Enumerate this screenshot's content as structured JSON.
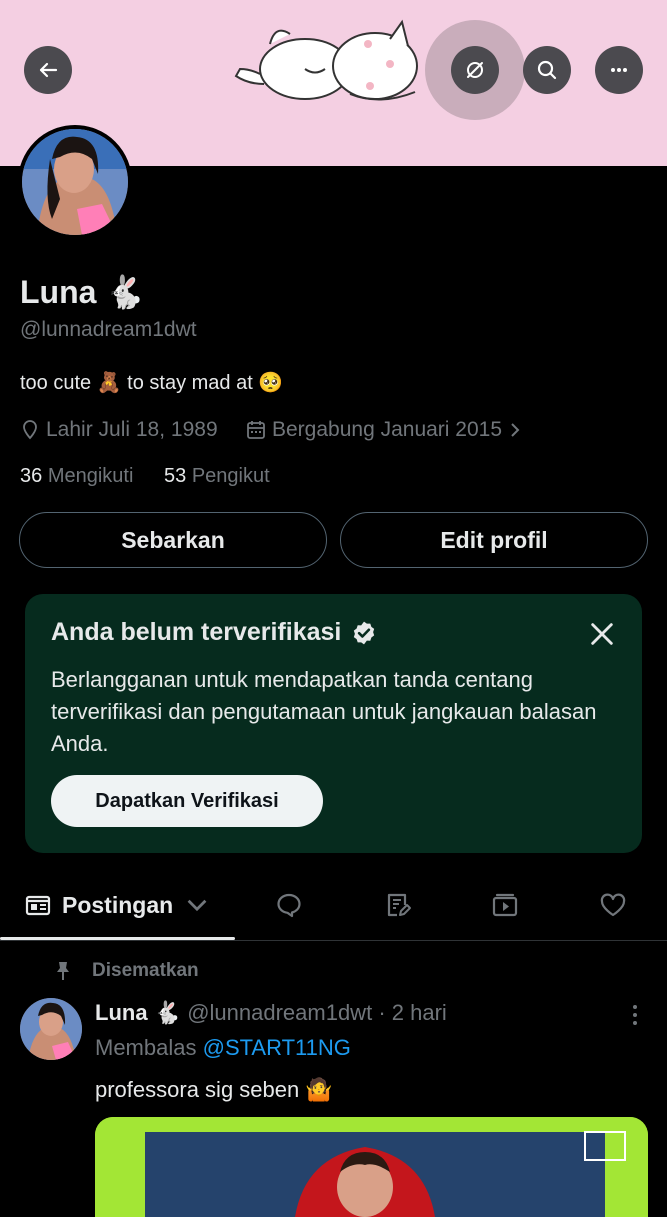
{
  "profile": {
    "name": "Luna 🐇",
    "handle": "@lunnadream1dwt",
    "bio": "too cute 🧸 to stay mad at 🥺",
    "birth": "Lahir Juli 18, 1989",
    "joined": "Bergabung Januari 2015",
    "following_count": "36",
    "following_label": "Mengikuti",
    "followers_count": "53",
    "followers_label": "Pengikut"
  },
  "actions": {
    "share_label": "Sebarkan",
    "edit_label": "Edit profil"
  },
  "verify_card": {
    "title": "Anda belum terverifikasi",
    "body": "Berlangganan untuk mendapatkan tanda centang terverifikasi dan pengutamaan untuk jangkauan balasan Anda.",
    "button": "Dapatkan Verifikasi"
  },
  "tabs": {
    "active_label": "Postingan"
  },
  "post": {
    "pinned_label": "Disematkan",
    "author_name": "Luna 🐇",
    "author_handle": "@lunnadream1dwt",
    "time": "· 2 hari",
    "reply_prefix": "Membalas",
    "reply_mention": "@START11NG",
    "text": "professora sig seben 🤷"
  },
  "colors": {
    "banner": "#f4cfe2",
    "card_bg": "#062b1e",
    "link": "#1d9bf0",
    "media_accent": "#a3e635"
  },
  "icons": [
    "back-arrow-icon",
    "hide-icon",
    "search-icon",
    "more-icon",
    "location-icon",
    "calendar-icon",
    "chevron-right-icon",
    "verified-badge-icon",
    "close-icon",
    "posts-icon",
    "chevron-down-icon",
    "replies-icon",
    "articles-icon",
    "media-icon",
    "likes-icon",
    "pin-icon",
    "more-vertical-icon"
  ]
}
